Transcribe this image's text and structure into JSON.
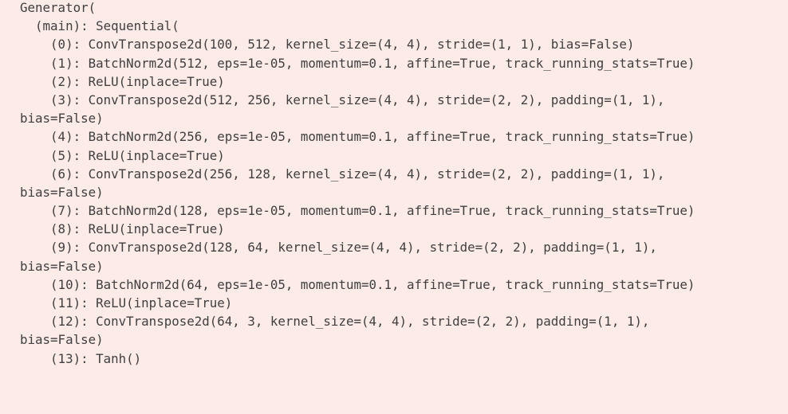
{
  "output": {
    "lines": [
      "Generator(",
      "  (main): Sequential(",
      "    (0): ConvTranspose2d(100, 512, kernel_size=(4, 4), stride=(1, 1), bias=False)",
      "    (1): BatchNorm2d(512, eps=1e-05, momentum=0.1, affine=True, track_running_stats=True)",
      "    (2): ReLU(inplace=True)",
      "    (3): ConvTranspose2d(512, 256, kernel_size=(4, 4), stride=(2, 2), padding=(1, 1),",
      "bias=False)",
      "    (4): BatchNorm2d(256, eps=1e-05, momentum=0.1, affine=True, track_running_stats=True)",
      "    (5): ReLU(inplace=True)",
      "    (6): ConvTranspose2d(256, 128, kernel_size=(4, 4), stride=(2, 2), padding=(1, 1),",
      "bias=False)",
      "    (7): BatchNorm2d(128, eps=1e-05, momentum=0.1, affine=True, track_running_stats=True)",
      "    (8): ReLU(inplace=True)",
      "    (9): ConvTranspose2d(128, 64, kernel_size=(4, 4), stride=(2, 2), padding=(1, 1),",
      "bias=False)",
      "    (10): BatchNorm2d(64, eps=1e-05, momentum=0.1, affine=True, track_running_stats=True)",
      "    (11): ReLU(inplace=True)",
      "    (12): ConvTranspose2d(64, 3, kernel_size=(4, 4), stride=(2, 2), padding=(1, 1),",
      "bias=False)",
      "    (13): Tanh()"
    ]
  }
}
